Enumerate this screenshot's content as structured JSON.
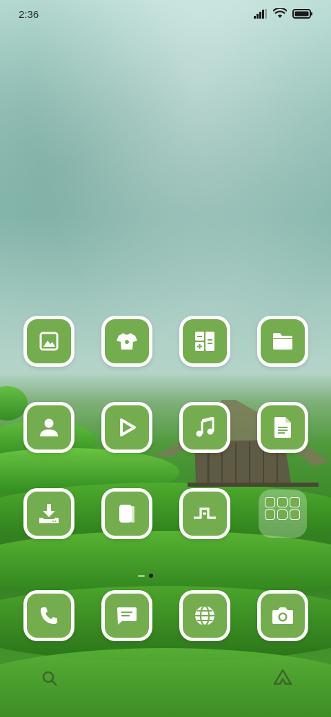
{
  "status_bar": {
    "time": "2:36",
    "icons": [
      "signal-icon",
      "wifi-icon",
      "battery-icon"
    ]
  },
  "colors": {
    "icon_fill": "#74ad4d",
    "icon_border": "#ffffff"
  },
  "apps": [
    {
      "name": "gallery",
      "icon": "image-icon"
    },
    {
      "name": "themes",
      "icon": "tshirt-icon"
    },
    {
      "name": "calculator",
      "icon": "calculator-icon"
    },
    {
      "name": "file-manager",
      "icon": "folder-icon"
    },
    {
      "name": "contacts",
      "icon": "person-icon"
    },
    {
      "name": "video-player",
      "icon": "play-icon"
    },
    {
      "name": "music",
      "icon": "music-note-icon"
    },
    {
      "name": "notes",
      "icon": "document-icon"
    },
    {
      "name": "downloads",
      "icon": "download-icon"
    },
    {
      "name": "notebook",
      "icon": "notebook-icon"
    },
    {
      "name": "recorder",
      "icon": "waveform-icon"
    },
    {
      "name": "tools-folder",
      "icon": "folder-grid-icon"
    }
  ],
  "dock": [
    {
      "name": "phone",
      "icon": "phone-icon"
    },
    {
      "name": "messages",
      "icon": "message-icon"
    },
    {
      "name": "browser",
      "icon": "globe-icon"
    },
    {
      "name": "camera",
      "icon": "camera-icon"
    }
  ],
  "page_indicator": {
    "pages": 2,
    "current": 2
  }
}
